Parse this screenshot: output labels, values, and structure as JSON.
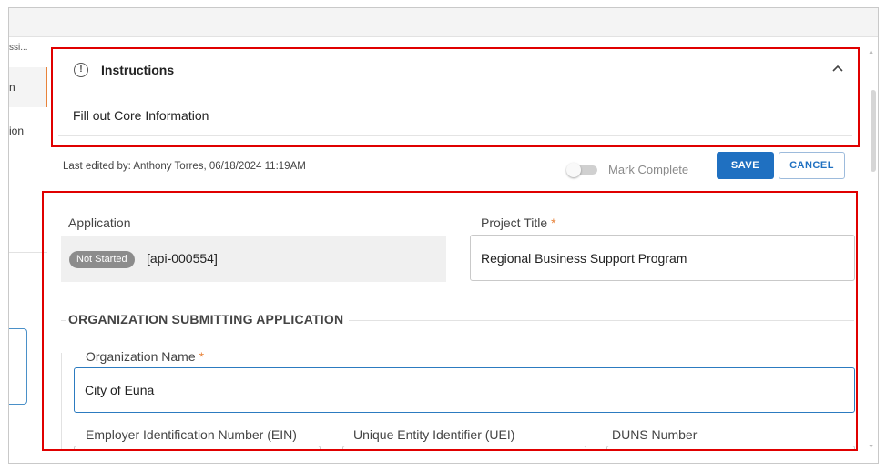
{
  "sidebar": {
    "items": [
      {
        "label": "ssi..."
      },
      {
        "label": "n"
      },
      {
        "label": "ion"
      }
    ]
  },
  "instructions": {
    "title": "Instructions",
    "icon": "alert-circle-icon",
    "text": "Fill out Core Information",
    "collapse_icon": "chevron-up-icon"
  },
  "toolbar": {
    "last_edited": "Last edited by: Anthony Torres, 06/18/2024 11:19AM",
    "mark_complete_label": "Mark Complete",
    "save_label": "SAVE",
    "cancel_label": "CANCEL"
  },
  "form": {
    "application": {
      "label": "Application",
      "status_badge": "Not Started",
      "id": "[api-000554]"
    },
    "project_title": {
      "label": "Project Title",
      "required_mark": "*",
      "value": "Regional Business Support Program"
    },
    "org_section_title": "ORGANIZATION SUBMITTING APPLICATION",
    "org_name": {
      "label": "Organization Name",
      "required_mark": "*",
      "value": "City of Euna"
    },
    "ein_label": "Employer Identification Number (EIN)",
    "uei_label": "Unique Entity Identifier (UEI)",
    "duns_label": "DUNS Number"
  },
  "colors": {
    "accent": "#1f70c1",
    "highlight_outline": "#e00000",
    "required": "#e8833a"
  }
}
